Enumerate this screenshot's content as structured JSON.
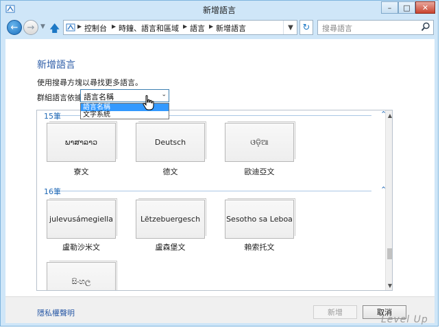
{
  "window": {
    "title": "新增語言"
  },
  "caption_buttons": {
    "minimize": "–",
    "maximize": "□",
    "close": "✕"
  },
  "nav": {
    "breadcrumbs": [
      "控制台",
      "時鐘、語言和區域",
      "語言",
      "新增語言"
    ],
    "search_placeholder": "搜尋語言"
  },
  "main": {
    "heading": "新增語言",
    "description": "使用搜尋方塊以尋找更多語言。",
    "group_by_label": "群組語言依據:",
    "group_by_value": "語言名稱",
    "dropdown_options": [
      "語言名稱",
      "文字系統"
    ]
  },
  "sections": [
    {
      "title": "15筆",
      "tiles": [
        {
          "native": "ພາສາລາວ",
          "caption": "寮文"
        },
        {
          "native": "Deutsch",
          "caption": "德文"
        },
        {
          "native": "ଓଡ଼ିଆ",
          "caption": "歐迪亞文"
        }
      ]
    },
    {
      "title": "16筆",
      "tiles": [
        {
          "native": "julevusámegiella",
          "caption": "盧勒沙米文"
        },
        {
          "native": "Lëtzebuergesch",
          "caption": "盧森堡文"
        },
        {
          "native": "Sesotho sa Leboa",
          "caption": "賴索托文"
        },
        {
          "native": "සිංහල",
          "caption": ""
        }
      ]
    }
  ],
  "footer": {
    "privacy_link": "隱私權聲明",
    "add_button": "新增",
    "cancel_button": "取消"
  },
  "watermark": "Level Up"
}
